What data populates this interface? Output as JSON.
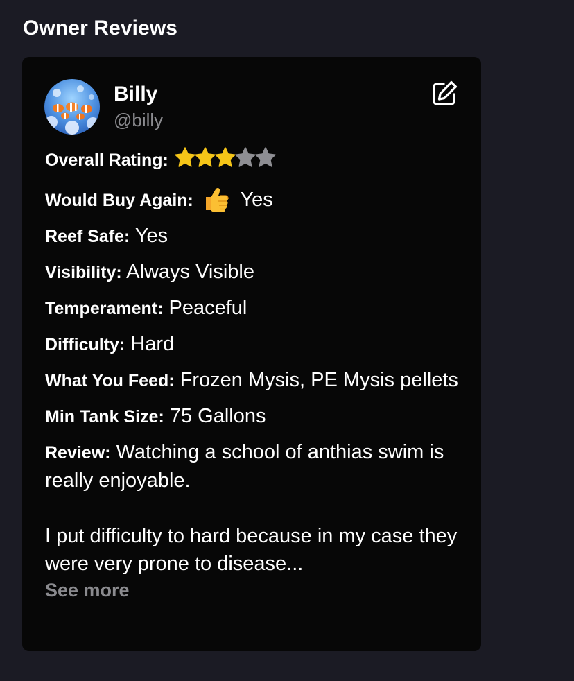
{
  "section": {
    "title": "Owner Reviews"
  },
  "review": {
    "user": {
      "name": "Billy",
      "handle": "@billy",
      "avatar_icon": "clownfish-avatar"
    },
    "edit_icon": "edit-icon",
    "rating": {
      "label": "Overall Rating:",
      "value": 3,
      "max": 5,
      "filled_color": "#f5c518",
      "empty_color": "#8e8e93"
    },
    "buy_again": {
      "label": "Would Buy Again:",
      "icon": "thumbs-up-icon",
      "value": "Yes"
    },
    "reef_safe": {
      "label": "Reef Safe:",
      "value": "Yes"
    },
    "visibility": {
      "label": "Visibility:",
      "value": "Always Visible"
    },
    "temperament": {
      "label": "Temperament:",
      "value": "Peaceful"
    },
    "difficulty": {
      "label": "Difficulty:",
      "value": "Hard"
    },
    "feed": {
      "label": "What You Feed:",
      "value": "Frozen Mysis, PE Mysis pellets"
    },
    "tank_size": {
      "label": "Min Tank Size:",
      "value": "75 Gallons"
    },
    "text": {
      "label": "Review:",
      "paragraph1": "Watching a school of anthias swim is really enjoyable.",
      "paragraph2": "I put difficulty to hard because in my case they were very prone to disease..."
    },
    "see_more_label": "See more"
  },
  "colors": {
    "page_bg": "#1b1b24",
    "card_bg": "#070707",
    "muted_text": "#8b8b8f"
  }
}
